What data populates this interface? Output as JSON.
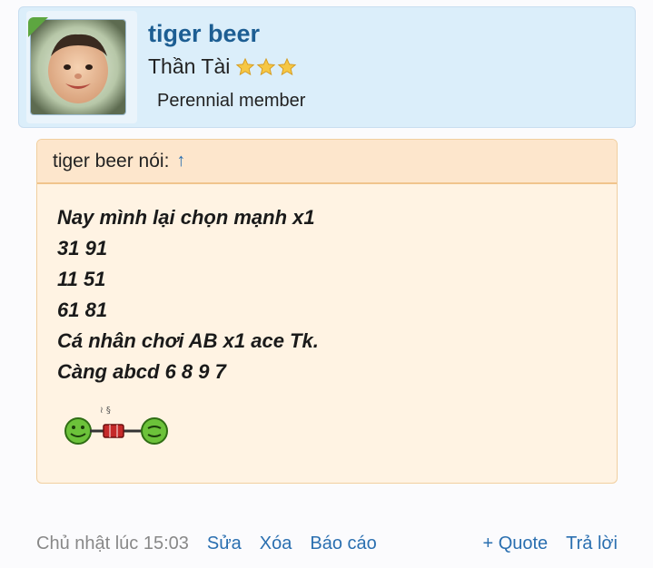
{
  "author": {
    "username": "tiger beer",
    "title": "Thần Tài",
    "stars": 3,
    "member_status": "Perennial member"
  },
  "quote": {
    "header_text": "tiger beer nói:",
    "header_arrow": "↑",
    "lines": [
      "Nay mình lại chọn mạnh x1",
      "31 91",
      "11 51",
      "61 81",
      "Cá nhân chơi AB x1 ace Tk.",
      "Càng abcd 6 8 9 7"
    ]
  },
  "footer": {
    "timestamp": "Chủ nhật lúc 15:03",
    "edit": "Sửa",
    "delete": "Xóa",
    "report": "Báo cáo",
    "quote": "+ Quote",
    "reply": "Trả lời"
  },
  "colors": {
    "accent": "#2a6fb0",
    "username": "#1d5e93",
    "card_bg": "#dbeefa",
    "quote_bg": "#fff3e3",
    "quote_header_bg": "#fde6cc",
    "online": "#5da640"
  }
}
